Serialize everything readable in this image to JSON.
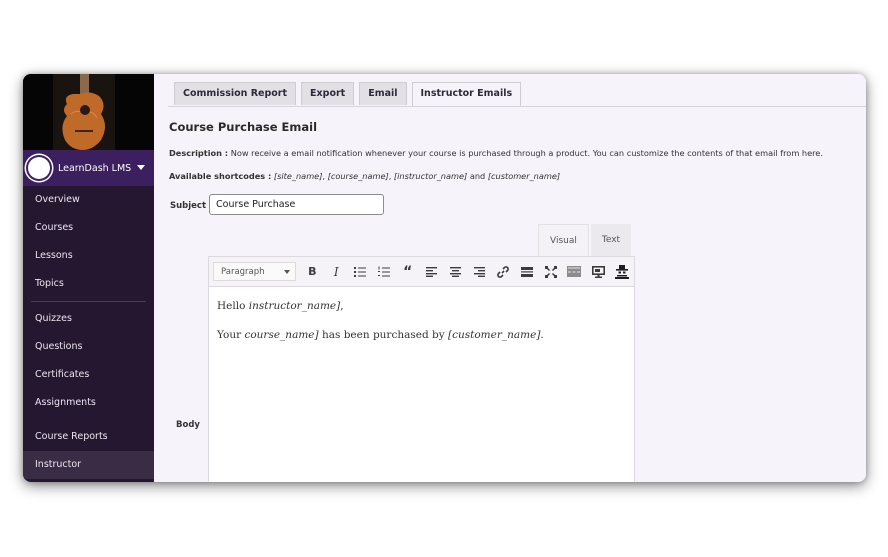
{
  "sidebar": {
    "site_name": "LearnDash LMS",
    "items": [
      {
        "label": "Overview"
      },
      {
        "label": "Courses"
      },
      {
        "label": "Lessons"
      },
      {
        "label": "Topics"
      },
      {
        "label": "Quizzes"
      },
      {
        "label": "Questions"
      },
      {
        "label": "Certificates"
      },
      {
        "label": "Assignments"
      },
      {
        "label": "Course Reports"
      },
      {
        "label": "Instructor",
        "active": true
      }
    ]
  },
  "tabs": [
    {
      "label": "Commission Report"
    },
    {
      "label": "Export"
    },
    {
      "label": "Email"
    },
    {
      "label": "Instructor Emails",
      "active": true
    }
  ],
  "page": {
    "title": "Course Purchase Email",
    "description_label": "Description :",
    "description_text": " Now receive a email notification whenever your course is purchased through a product. You can customize the contents of that email from here.",
    "shortcodes_label": "Available shortcodes :",
    "shortcodes": [
      "[site_name]",
      "[course_name]",
      "[instructor_name]",
      "[customer_name]"
    ],
    "shortcodes_and": " and ",
    "subject_label": "Subject",
    "subject_value": "Course Purchase",
    "body_label": "Body"
  },
  "editor": {
    "tabs": {
      "visual": "Visual",
      "text": "Text"
    },
    "format_select": "Paragraph",
    "toolbar_icons": [
      "bold-icon",
      "italic-icon",
      "bullet-list-icon",
      "numbered-list-icon",
      "blockquote-icon",
      "align-left-icon",
      "align-center-icon",
      "align-right-icon",
      "link-icon",
      "read-more-icon",
      "fullscreen-icon",
      "toolbar-toggle-icon",
      "monitor-icon",
      "incognito-icon"
    ],
    "content": {
      "line1_prefix": "Hello ",
      "line1_code": "instructor_name]",
      "line1_suffix": ",",
      "line2_prefix": "Your ",
      "line2_code": "course_name]",
      "line2_middle": " has been purchased by ",
      "line2_code2": "[customer_name]",
      "line2_suffix": "."
    }
  },
  "colors": {
    "sidebar_bg": "#261731",
    "site_bar": "#3b1f5e",
    "main_bg": "#f7f3fa"
  }
}
